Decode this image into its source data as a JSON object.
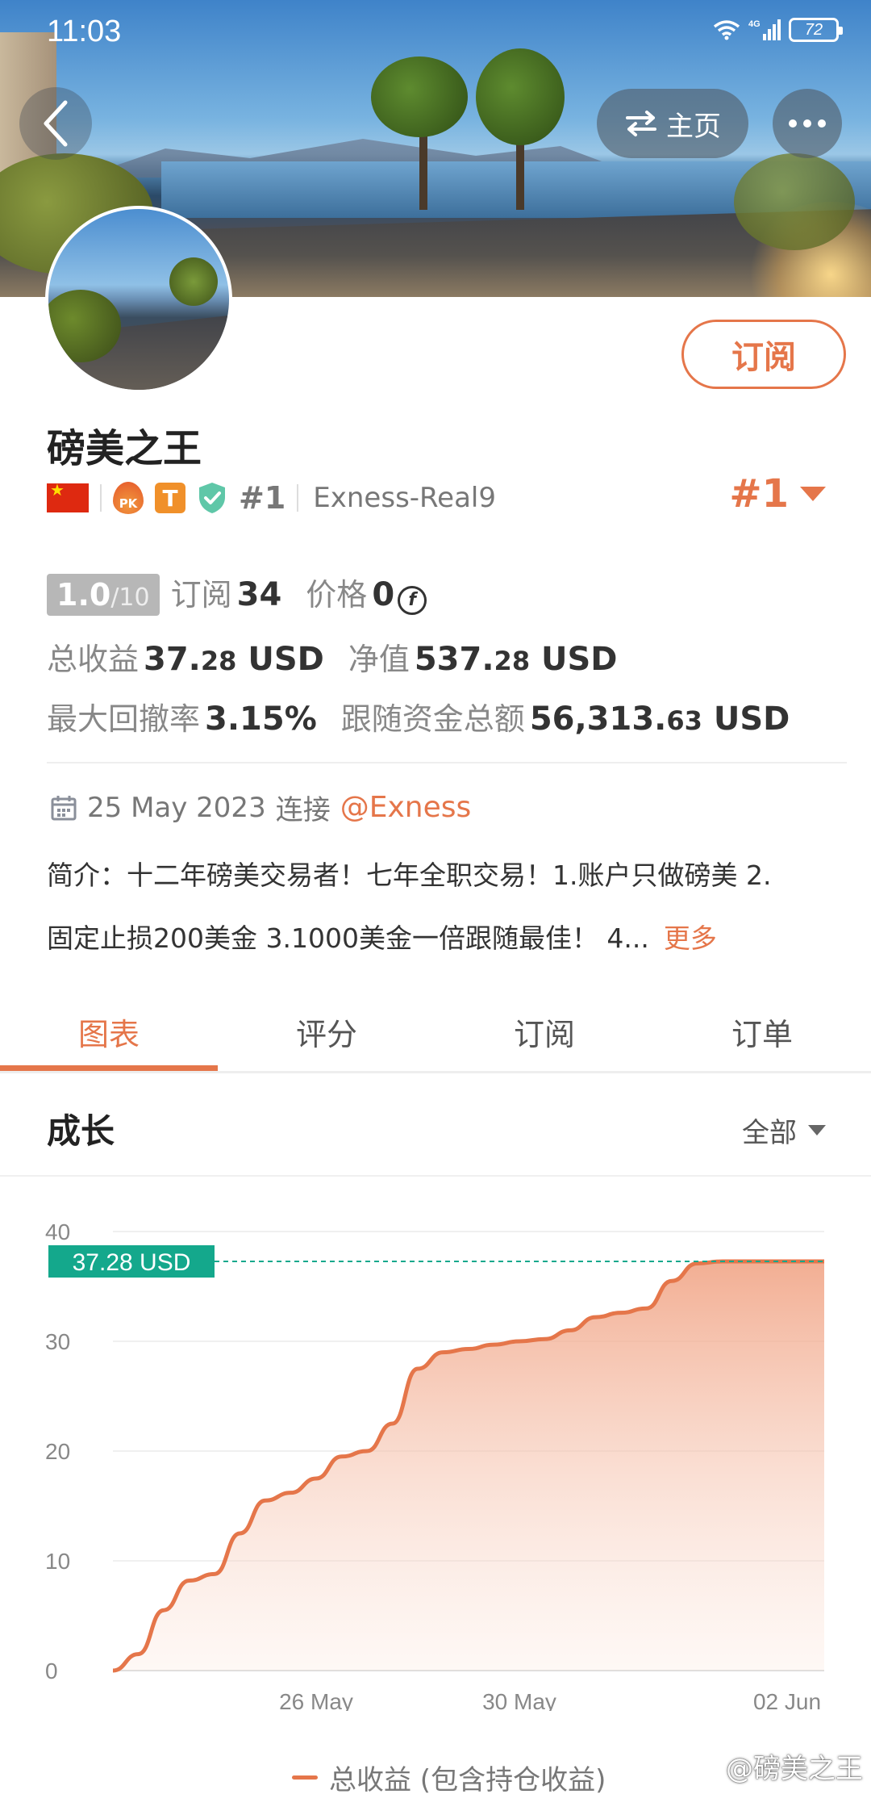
{
  "status_bar": {
    "time": "11:03",
    "battery": "72",
    "network": "4G"
  },
  "nav": {
    "home_label": "主页"
  },
  "profile": {
    "subscribe_label": "订阅",
    "name": "磅美之王",
    "pk_badge": "PK",
    "t_badge": "T",
    "rank_small": "#1",
    "broker_account": "Exness-Real9",
    "rank_badge": "#1"
  },
  "stats": {
    "score_main": "1.0",
    "score_den": "/10",
    "subscribe_label": "订阅",
    "subscribe_count": "34",
    "price_label": "价格",
    "price_value": "0",
    "coin_symbol": "f",
    "total_profit_label": "总收益",
    "total_profit_int": "37.",
    "total_profit_dec": "28",
    "total_profit_unit": " USD",
    "equity_label": "净值",
    "equity_int": "537.",
    "equity_dec": "28",
    "equity_unit": " USD",
    "max_drawdown_label": "最大回撤率",
    "max_drawdown_value": "3.15%",
    "follow_funds_label": "跟随资金总额",
    "follow_funds_int": "56,313.",
    "follow_funds_dec": "63",
    "follow_funds_unit": " USD"
  },
  "connect": {
    "date": "25 May 2023",
    "text": "连接",
    "broker": "@Exness"
  },
  "bio": {
    "line1": "简介：十二年磅美交易者！七年全职交易！1.账户只做磅美 2.",
    "line2": "固定止损200美金 3.1000美金一倍跟随最佳！ 4...",
    "more_label": "更多"
  },
  "tabs": [
    {
      "label": "图表"
    },
    {
      "label": "评分"
    },
    {
      "label": "订阅"
    },
    {
      "label": "订单"
    }
  ],
  "section": {
    "title": "成长",
    "filter": "全部"
  },
  "legend": {
    "label": "总收益 (包含持仓收益)"
  },
  "watermark": {
    "text": "@磅美之王"
  },
  "colors": {
    "accent": "#e5764a",
    "badge_green": "#14a88c",
    "shield": "#5fc7a8"
  },
  "chart_data": {
    "type": "area",
    "y_ticks": [
      0,
      10,
      20,
      30,
      40
    ],
    "ylim": [
      0,
      40
    ],
    "x_tick_labels": [
      "26 May",
      "30 May",
      "02 Jun"
    ],
    "current_value_label": "37.28 USD",
    "current_value": 37.28,
    "series": [
      {
        "name": "总收益 (包含持仓收益)",
        "x": [
          0,
          0.5,
          1,
          1.5,
          2,
          2.5,
          3,
          3.5,
          4,
          4.5,
          5,
          5.5,
          6,
          6.5,
          7,
          7.5,
          8,
          8.5,
          9,
          9.5,
          10,
          10.5,
          11,
          11.5,
          12,
          12.5,
          13,
          13.5,
          14
        ],
        "values": [
          0,
          1.5,
          5.5,
          8.2,
          8.8,
          12.5,
          15.5,
          16.2,
          17.5,
          19.5,
          20.0,
          22.5,
          27.5,
          29.0,
          29.3,
          29.7,
          30.0,
          30.2,
          31.0,
          32.2,
          32.6,
          33.0,
          35.5,
          37.1,
          37.28,
          37.28,
          37.28,
          37.28,
          37.28
        ]
      }
    ]
  }
}
